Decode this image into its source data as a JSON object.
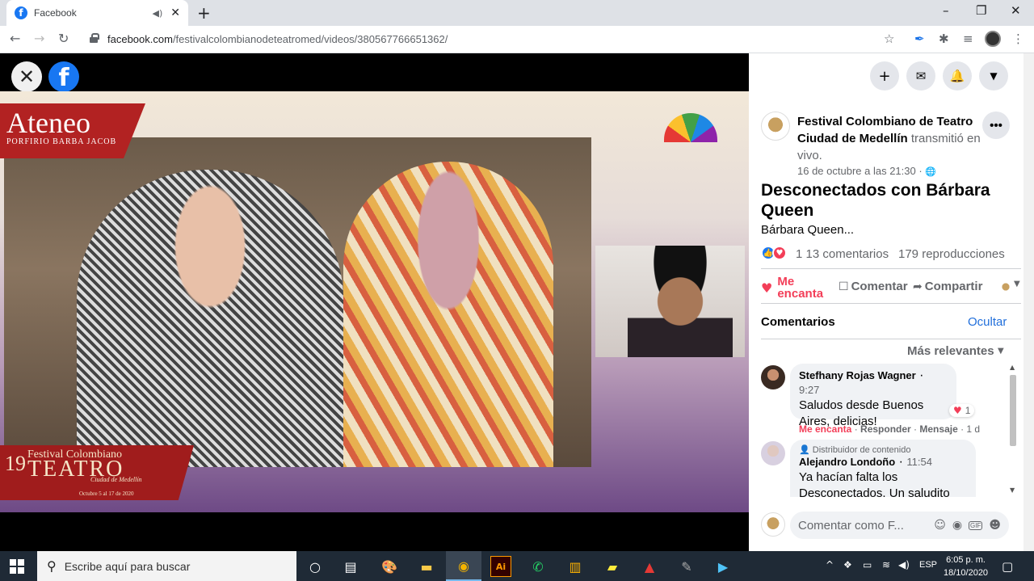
{
  "browser": {
    "tab_title": "Facebook",
    "tab_icon": "facebook-icon",
    "url_domain": "facebook.com",
    "url_path": "/festivalcolombianodeteatromed/videos/380567766651362/"
  },
  "video": {
    "overlay_top_title": "Ateneo",
    "overlay_top_subtitle": "PORFIRIO BARBA JACOB",
    "overlay_bottom_title": "Festival Colombiano",
    "overlay_bottom_number": "19",
    "overlay_bottom_teatro": "TEATRO",
    "overlay_bottom_city": "Ciudad de Medellín",
    "overlay_bottom_dates": "Octubre 5 al 17 de 2020"
  },
  "post": {
    "page_name": "Festival Colombiano de Teatro Ciudad de Medellín",
    "action_text": " transmitió en vivo.",
    "date": "16 de octubre a las 21:30 · ",
    "title": "Desconectados con Bárbara Queen",
    "description": "Bárbara Queen...",
    "reaction_count": "1",
    "comments_count": "13 comentarios",
    "views_count": "179 reproducciones"
  },
  "actions": {
    "love_line1": "Me",
    "love_line2": "encanta",
    "comment": "Comentar",
    "share": "Compartir"
  },
  "comments_section": {
    "label": "Comentarios",
    "hide": "Ocultar",
    "sort": "Más relevantes",
    "items": [
      {
        "author": "Stefhany Rojas Wagner",
        "time": "9:27",
        "text": "Saludos desde Buenos Aires, delicias!",
        "reaction_count": "1",
        "action_love": "Me encanta",
        "action_reply": "Responder",
        "action_message": "Mensaje",
        "age": "1 d"
      },
      {
        "badge": "Distribuidor de contenido",
        "author": "Alejandro Londoño",
        "time": "11:54",
        "text": "Ya hacían falta los Desconectados. Un saludito"
      }
    ]
  },
  "compose": {
    "placeholder": "Comentar como F..."
  },
  "taskbar": {
    "search_placeholder": "Escribe aquí para buscar",
    "language": "ESP",
    "time": "6:05 p. m.",
    "date": "18/10/2020"
  },
  "colors": {
    "facebook_blue": "#1877f2",
    "love_red": "#f33e58",
    "link_blue": "#216fdb"
  }
}
